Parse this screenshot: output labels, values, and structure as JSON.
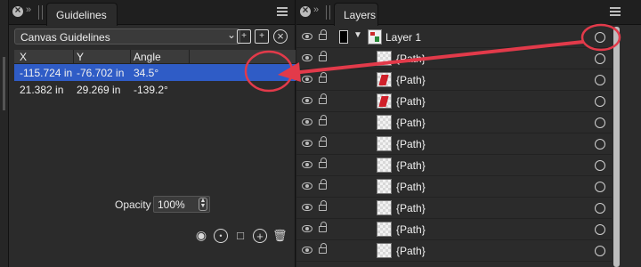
{
  "guidelines_panel": {
    "tab_label": "Guidelines",
    "tab_arrows": "»",
    "select_value": "Canvas Guidelines",
    "buttons": [
      "add-page-icon",
      "add-guide-icon",
      "remove-guide-icon"
    ],
    "columns": [
      "X",
      "Y",
      "Angle"
    ],
    "rows": [
      {
        "x": "-115.724 in",
        "y": "-76.702 in",
        "angle": "34.5°",
        "selected": true
      },
      {
        "x": "21.382 in",
        "y": "29.269 in",
        "angle": "-139.2°",
        "selected": false
      }
    ],
    "opacity_label": "Opacity",
    "opacity_value": "100%",
    "bottom_icons": [
      "eye-icon",
      "color-pick-icon",
      "lock-icon",
      "add-icon",
      "trash-icon"
    ]
  },
  "layers_panel": {
    "tab_label": "Layers",
    "tab_arrows": "»",
    "layer_name": "Layer 1",
    "paths": [
      "{Path}",
      "{Path}",
      "{Path}",
      "{Path}",
      "{Path}",
      "{Path}",
      "{Path}",
      "{Path}",
      "{Path}",
      "{Path}"
    ],
    "thumb_red": [
      false,
      true,
      true,
      false,
      false,
      false,
      false,
      false,
      false,
      false
    ]
  },
  "colors": {
    "selection": "#2f5cc6",
    "annotation": "#e23a4a",
    "panel_bg": "#2b2b2b"
  }
}
